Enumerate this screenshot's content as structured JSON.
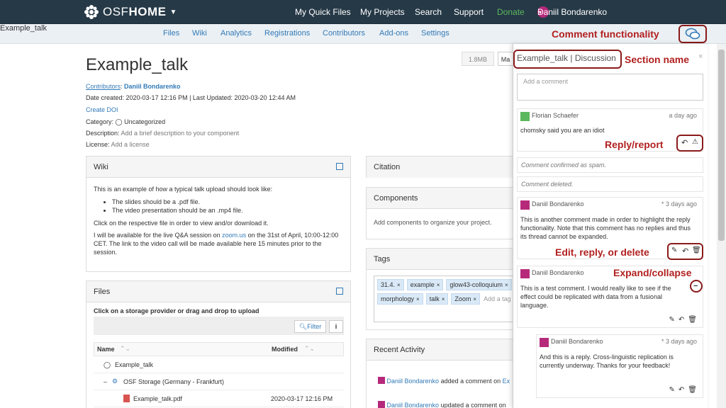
{
  "topbar": {
    "brand_light": "OSF",
    "brand_bold": "HOME",
    "nav": [
      "My Quick Files",
      "My Projects",
      "Search",
      "Support"
    ],
    "donate": "Donate",
    "user": "Daniil Bondarenko"
  },
  "subnav": {
    "project": "Example_talk",
    "items": [
      "Files",
      "Wiki",
      "Analytics",
      "Registrations",
      "Contributors",
      "Add-ons",
      "Settings"
    ]
  },
  "project": {
    "title": "Example_talk",
    "contributors_label": "Contributors",
    "contributor": "Daniil Bondarenko",
    "dates": "Date created: 2020-03-17 12:16 PM | Last Updated: 2020-03-20 12:44 AM",
    "create_doi": "Create DOI",
    "category_label": "Category:",
    "category": "Uncategorized",
    "description_label": "Description:",
    "description": "Add a brief description to your component",
    "license_label": "License:",
    "license": "Add a license",
    "size_badge": "1.8MB",
    "partial_btn": "Ma"
  },
  "wiki": {
    "title": "Wiki",
    "intro": "This is an example of how a typical talk upload should look like:",
    "bullets": [
      "The slides should be a .pdf file.",
      "The video presentation should be an .mp4 file."
    ],
    "p2": "Click on the respective file in order to view and/or download it.",
    "p3_a": "I will be available for the live Q&A session on ",
    "p3_link": "zoom.us",
    "p3_b": " on the 31st of April, 10:00-12:00 CET. The link to the video call will be made available here 15 minutes prior to the session."
  },
  "files": {
    "title": "Files",
    "hint": "Click on a storage provider or drag and drop to upload",
    "filter": "Filter",
    "col_name": "Name",
    "col_modified": "Modified",
    "rows": [
      {
        "name": "Example_talk",
        "modified": ""
      },
      {
        "name": "OSF Storage (Germany - Frankfurt)",
        "modified": ""
      },
      {
        "name": "Example_talk.pdf",
        "modified": "2020-03-17 12:16 PM"
      }
    ]
  },
  "citation": {
    "title": "Citation"
  },
  "components": {
    "title": "Components",
    "body": "Add components to organize your project."
  },
  "tags": {
    "title": "Tags",
    "items": [
      "31.4.",
      "example",
      "glow43-colloquium",
      "morphology",
      "talk",
      "Zoom"
    ],
    "add_placeholder": "Add a tag"
  },
  "recent": {
    "title": "Recent Activity",
    "items": [
      {
        "user": "Daniil Bondarenko",
        "text": " added a comment on ",
        "trail": "Ex"
      },
      {
        "user": "Daniil Bondarenko",
        "text": " updated a comment on ",
        "trail": ""
      }
    ]
  },
  "drawer": {
    "header": "Example_talk | Discussion",
    "close": "×",
    "placeholder": "Add a comment",
    "comments": [
      {
        "user": "Florian Schaefer",
        "when": "a day ago",
        "text": "chomsky said you are an idiot"
      },
      {
        "spam": "Comment confirmed as spam."
      },
      {
        "deleted": "Comment deleted."
      },
      {
        "user": "Daniil Bondarenko",
        "when": "* 3 days ago",
        "text": "This is another comment made in order to highlight the reply functionality. Note that this comment has no replies and thus its thread cannot be expanded."
      },
      {
        "user": "Daniil Bondarenko",
        "when": "",
        "text": "This is a test comment. I would really like to see if the effect could be replicated with data from a fusional language."
      },
      {
        "user": "Daniil Bondarenko",
        "when": "* 3 days ago",
        "text": "And this is a reply. Cross-linguistic replication is currently underway. Thanks for your feedback!"
      }
    ]
  },
  "annotations": {
    "comment_functionality": "Comment functionality",
    "section_name": "Section name",
    "reply_report": "Reply/report",
    "edit_reply_delete": "Edit, reply, or delete",
    "expand_collapse": "Expand/collapse"
  },
  "colors": {
    "navbar": "#263947",
    "accent": "#337ab7",
    "annotation": "#b22020",
    "donate": "#5cb85c"
  }
}
